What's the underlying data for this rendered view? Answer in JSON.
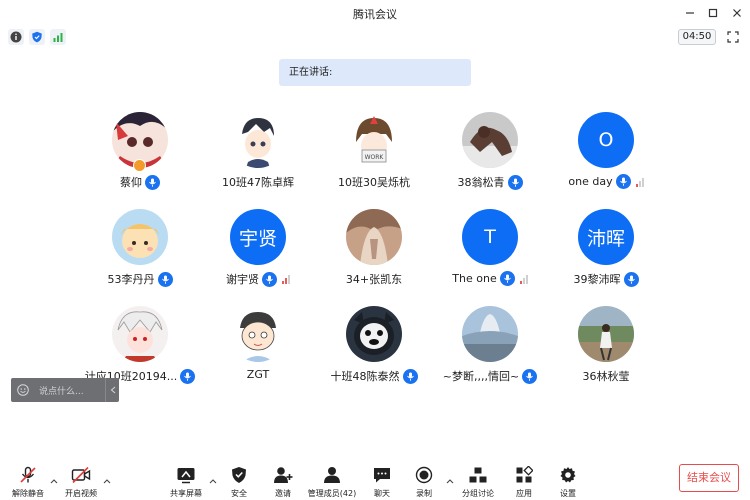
{
  "window": {
    "title": "腾讯会议"
  },
  "infobar": {
    "timer": "04:50"
  },
  "speaking": {
    "label": "正在讲话:"
  },
  "participants": [
    {
      "name": "蔡仰",
      "avatar": "photo",
      "mic": true,
      "host": true
    },
    {
      "name": "10班47陈卓辉",
      "avatar": "photo",
      "mic": false
    },
    {
      "name": "10班30吴烁杭",
      "avatar": "photo",
      "mic": false
    },
    {
      "name": "38翁松青",
      "avatar": "photo",
      "mic": true
    },
    {
      "name": "one  day",
      "avatar": "letter",
      "letter": "O",
      "mic": true,
      "signal": true
    },
    {
      "name": "53李丹丹",
      "avatar": "photo",
      "mic": true
    },
    {
      "name": "谢宇贤",
      "avatar": "letter",
      "letter": "宇贤",
      "mic": true,
      "signal": true
    },
    {
      "name": "34+张凯东",
      "avatar": "photo",
      "mic": false
    },
    {
      "name": "The one",
      "avatar": "letter",
      "letter": "T",
      "mic": true,
      "signal": true
    },
    {
      "name": "39黎沛晖",
      "avatar": "letter",
      "letter": "沛晖",
      "mic": true
    },
    {
      "name": "计应10班20194...",
      "avatar": "photo",
      "mic": true
    },
    {
      "name": "ZGT",
      "avatar": "photo",
      "mic": false
    },
    {
      "name": "十班48陈泰然",
      "avatar": "photo",
      "mic": true
    },
    {
      "name": "~梦断,,,,情回~",
      "avatar": "photo",
      "mic": true
    },
    {
      "name": "36林秋莹",
      "avatar": "photo",
      "mic": false
    }
  ],
  "chat": {
    "placeholder": "说点什么..."
  },
  "toolbar": {
    "unmute": "解除静音",
    "start_video": "开启视频",
    "share_screen": "共享屏幕",
    "security": "安全",
    "invite": "邀请",
    "manage_members": "管理成员(42)",
    "chat": "聊天",
    "record": "录制",
    "breakout": "分组讨论",
    "apps": "应用",
    "settings": "设置",
    "end_meeting": "结束会议"
  },
  "colors": {
    "accent": "#0d6ef5",
    "end": "#e74c4c",
    "banner": "#dde9fb"
  }
}
